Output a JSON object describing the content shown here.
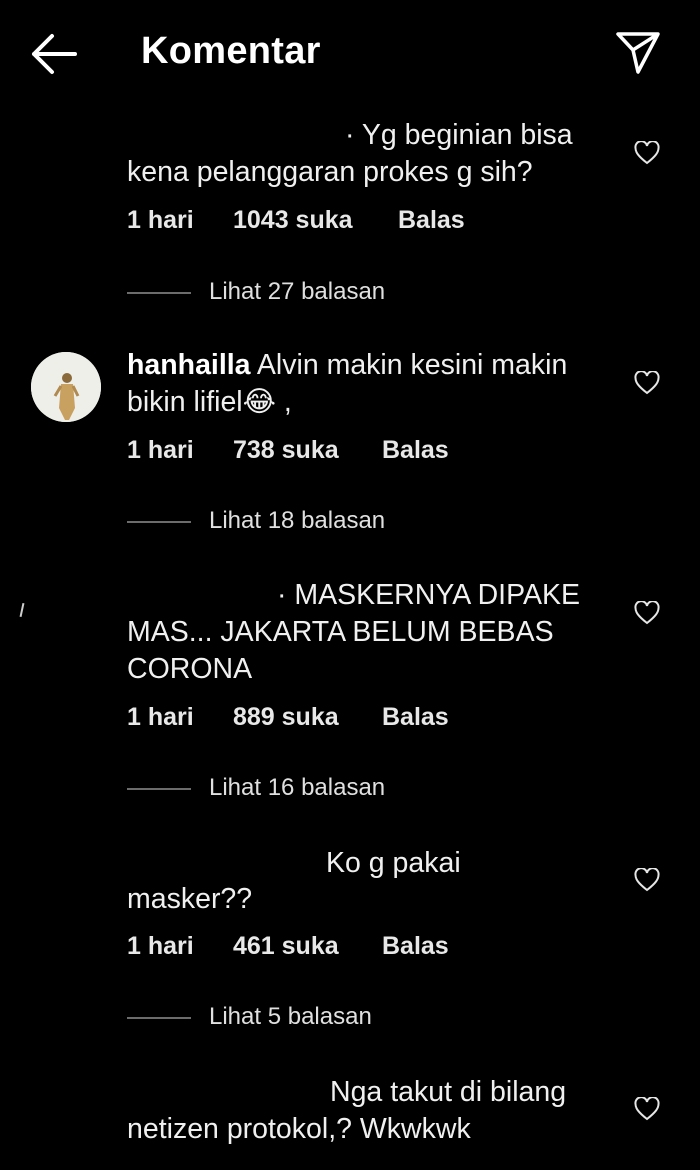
{
  "header": {
    "title": "Komentar",
    "back_icon": "arrow-left-icon",
    "share_icon": "paper-plane-icon"
  },
  "colors": {
    "background": "#000000",
    "text": "#f2f2f2",
    "divider": "#6c6c6c"
  },
  "comments": [
    {
      "text_line1": "· Yg beginian bisa",
      "text_line2": "kena pelanggaran prokes g sih?",
      "time": "1 hari",
      "likes": "1043 suka",
      "reply": "Balas",
      "view_replies": "Lihat 27 balasan"
    },
    {
      "username": "hanhailla",
      "text_line1": " Alvin makin kesini makin",
      "text_line2": "bikin lifiel😂 ,",
      "time": "1 hari",
      "likes": "738 suka",
      "reply": "Balas",
      "view_replies": "Lihat 18 balasan"
    },
    {
      "text_line1": "· MASKERNYA DIPAKE",
      "text_line2": "MAS... JAKARTA BELUM BEBAS",
      "text_line3": "CORONA",
      "time": "1 hari",
      "likes": "889 suka",
      "reply": "Balas",
      "view_replies": "Lihat 16 balasan"
    },
    {
      "text_line1": "Ko g pakai",
      "text_line2": "masker??",
      "time": "1 hari",
      "likes": "461 suka",
      "reply": "Balas",
      "view_replies": "Lihat 5 balasan"
    },
    {
      "text_line1": "Nga takut di bilang",
      "text_line2": "netizen protokol,? Wkwkwk"
    }
  ]
}
